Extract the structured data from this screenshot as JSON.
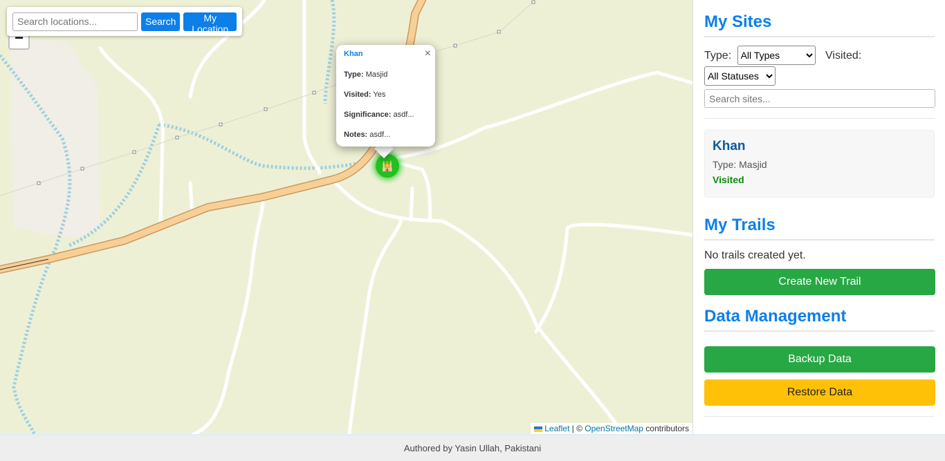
{
  "search": {
    "placeholder": "Search locations...",
    "search_label": "Search",
    "location_label": "My Location"
  },
  "zoom": {
    "out_label": "−"
  },
  "popup": {
    "title": "Khan",
    "close_label": "×",
    "rows": [
      {
        "label": "Type:",
        "value": "Masjid"
      },
      {
        "label": "Visited:",
        "value": "Yes"
      },
      {
        "label": "Significance:",
        "value": "asdf..."
      },
      {
        "label": "Notes:",
        "value": "asdf..."
      }
    ]
  },
  "marker": {
    "icon": "mosque-icon",
    "glyph": "🕌"
  },
  "attribution": {
    "leaflet": "Leaflet",
    "sep": " | © ",
    "osm": "OpenStreetMap",
    "suffix": " contributors"
  },
  "sidebar": {
    "sites_title": "My Sites",
    "type_label": "Type:",
    "type_value": "All Types",
    "visited_label": "Visited:",
    "visited_value": "All Statuses",
    "search_placeholder": "Search sites...",
    "site": {
      "name": "Khan",
      "type": "Type: Masjid",
      "status": "Visited"
    },
    "trails_title": "My Trails",
    "no_trails": "No trails created yet.",
    "create_trail": "Create New Trail",
    "data_title": "Data Management",
    "backup": "Backup Data",
    "restore": "Restore Data"
  },
  "footer": {
    "text": "Authored by Yasin Ullah, Pakistani"
  },
  "colors": {
    "accent": "#0d7fe9",
    "green": "#28a745",
    "yellow": "#ffc107",
    "visited": "#0a8a0a",
    "map_bg": "#eef0d6"
  }
}
